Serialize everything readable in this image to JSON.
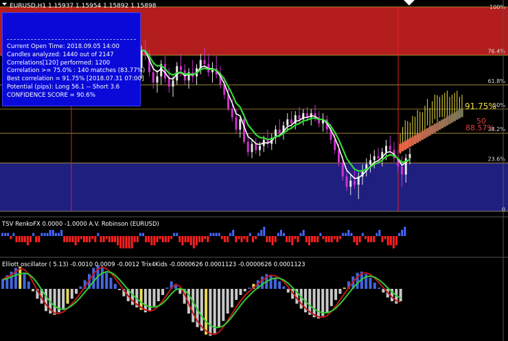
{
  "colors": {
    "background": "#000000",
    "bull_candle": "#e8e8e8",
    "bear_candle": "#cc33cc",
    "fast_ma": "#ffffff",
    "slow_ma": "#33dd33",
    "zone_top": "#b31d1d",
    "zone_bottom": "#1f1f80",
    "fib_line": "#e0c24a",
    "info_panel": "#0a0ad8",
    "histogram_up": "#4466ff",
    "histogram_down": "#ff2020",
    "elliott_up": "#4466dd",
    "elliott_down": "#c8c8c8",
    "elliott_highlight": "#e8d85a"
  },
  "chart_data": [
    {
      "type": "candlestick",
      "title": "EURUSD,H1  1.15937 1.15954 1.15892 1.15898",
      "symbol": "EURUSD",
      "timeframe": "H1",
      "ohlc": [
        1.15937,
        1.15954,
        1.15892,
        1.15898
      ],
      "fib_levels": [
        {
          "label": "100%",
          "pct": 100
        },
        {
          "label": "76.4%",
          "pct": 76.4
        },
        {
          "label": "61.8%",
          "pct": 61.8
        },
        {
          "label": "50%",
          "pct": 50
        },
        {
          "label": "38.2%",
          "pct": 38.2
        },
        {
          "label": "23.6%",
          "pct": 23.6
        },
        {
          "label": "0",
          "pct": 0
        }
      ],
      "zones": [
        {
          "name": "upper",
          "from_pct": 76.4,
          "to_pct": 100,
          "color": "#b31d1d"
        },
        {
          "name": "lower",
          "from_pct": 0,
          "to_pct": 23.6,
          "color": "#1f1f80"
        }
      ],
      "candles_pct": [
        [
          70,
          81,
          65,
          79
        ],
        [
          79,
          84,
          74,
          77
        ],
        [
          77,
          79,
          66,
          68
        ],
        [
          68,
          72,
          60,
          63
        ],
        [
          63,
          69,
          58,
          66
        ],
        [
          66,
          74,
          62,
          72
        ],
        [
          72,
          76,
          63,
          65
        ],
        [
          65,
          70,
          58,
          61
        ],
        [
          61,
          66,
          56,
          64
        ],
        [
          64,
          73,
          62,
          71
        ],
        [
          71,
          77,
          66,
          69
        ],
        [
          69,
          72,
          62,
          64
        ],
        [
          64,
          70,
          60,
          68
        ],
        [
          68,
          74,
          63,
          66
        ],
        [
          66,
          72,
          62,
          70
        ],
        [
          70,
          77,
          67,
          74
        ],
        [
          74,
          80,
          70,
          72
        ],
        [
          72,
          77,
          66,
          68
        ],
        [
          68,
          73,
          63,
          70
        ],
        [
          70,
          76,
          65,
          67
        ],
        [
          67,
          71,
          60,
          62
        ],
        [
          62,
          66,
          55,
          57
        ],
        [
          57,
          60,
          49,
          50
        ],
        [
          50,
          55,
          44,
          46
        ],
        [
          46,
          50,
          38,
          40
        ],
        [
          40,
          47,
          36,
          45
        ],
        [
          45,
          48,
          33,
          34
        ],
        [
          34,
          38,
          27,
          29
        ],
        [
          29,
          35,
          26,
          33
        ],
        [
          33,
          36,
          28,
          30
        ],
        [
          30,
          34,
          27,
          32
        ],
        [
          32,
          37,
          29,
          35
        ],
        [
          35,
          40,
          31,
          33
        ],
        [
          33,
          38,
          30,
          36
        ],
        [
          36,
          42,
          33,
          40
        ],
        [
          40,
          45,
          36,
          38
        ],
        [
          38,
          44,
          35,
          42
        ],
        [
          42,
          48,
          39,
          45
        ],
        [
          45,
          49,
          41,
          43
        ],
        [
          43,
          49,
          40,
          47
        ],
        [
          47,
          51,
          43,
          45
        ],
        [
          45,
          50,
          42,
          48
        ],
        [
          48,
          51,
          44,
          46
        ],
        [
          46,
          50,
          42,
          48
        ],
        [
          48,
          52,
          44,
          46
        ],
        [
          46,
          49,
          41,
          43
        ],
        [
          43,
          48,
          39,
          45
        ],
        [
          45,
          47,
          38,
          40
        ],
        [
          40,
          43,
          33,
          35
        ],
        [
          35,
          39,
          28,
          30
        ],
        [
          30,
          33,
          22,
          24
        ],
        [
          24,
          27,
          15,
          17
        ],
        [
          17,
          21,
          10,
          12
        ],
        [
          12,
          18,
          8,
          15
        ],
        [
          15,
          20,
          11,
          13
        ],
        [
          13,
          19,
          6,
          17
        ],
        [
          17,
          23,
          13,
          20
        ],
        [
          20,
          26,
          17,
          23
        ],
        [
          23,
          28,
          19,
          25
        ],
        [
          25,
          30,
          21,
          27
        ],
        [
          27,
          31,
          23,
          26
        ],
        [
          26,
          31,
          22,
          29
        ],
        [
          29,
          35,
          25,
          32
        ],
        [
          32,
          37,
          27,
          30
        ],
        [
          30,
          34,
          24,
          26
        ],
        [
          26,
          30,
          19,
          22
        ],
        [
          22,
          27,
          12,
          18
        ],
        [
          18,
          28,
          14,
          26
        ],
        [
          26,
          31,
          23,
          28
        ]
      ],
      "forecast": {
        "correlations": [
          {
            "label": "91.75%",
            "value": 91.75,
            "color": "#f0e040"
          },
          {
            "label": "88.57%",
            "value": 88.57,
            "color": "#e04040"
          }
        ],
        "mid_label": "50"
      }
    },
    {
      "type": "bar",
      "title": "TSV  RenkoFX 0.0000 -1.0000  A.V. Robinson (EURUSD)",
      "values": [
        1,
        1,
        1,
        -1,
        1,
        -2,
        -2,
        -2,
        -2,
        -3,
        -2,
        1,
        -2,
        -2,
        1,
        1,
        1,
        2,
        2,
        1,
        1,
        2,
        -2,
        -2,
        -2,
        -2,
        -3,
        -2,
        -1,
        -2,
        -2,
        -2,
        -1,
        -2,
        1,
        -2,
        -2,
        -1,
        -2,
        -2,
        -2,
        -3,
        -4,
        -4,
        -4,
        -4,
        -4,
        -2,
        -2,
        1,
        1,
        -2,
        -2,
        -3,
        -3,
        -2,
        -1,
        -2,
        -2,
        -2,
        -1,
        1,
        1,
        -2,
        -3,
        -2,
        -2,
        -3,
        -4,
        -3,
        -2,
        -2,
        -1,
        -2,
        1,
        1,
        1,
        1,
        -1,
        -2,
        -2,
        1,
        2,
        -2,
        -1,
        -2,
        -1,
        -2,
        1,
        -2,
        -1,
        1,
        2,
        3,
        -2,
        -2,
        -3,
        -2,
        1,
        2,
        1,
        -2,
        -2,
        -3,
        -1,
        -2,
        1,
        2,
        -2,
        -3,
        -2,
        -2,
        -2,
        1,
        -1,
        -2,
        -2,
        -2,
        -1,
        -2,
        -1,
        1,
        1,
        2,
        1,
        -2,
        -3,
        -2,
        1,
        -1,
        -2,
        -2,
        -2,
        1,
        2,
        -2,
        -1,
        -3,
        -3,
        -4,
        -3,
        1,
        2,
        3
      ],
      "ylim": [
        -4,
        3
      ]
    },
    {
      "type": "bar",
      "title": "Elliott oscillator ( 5.13) -0.0010 0.0009 -0.0012  Trix4Kids -0.0000626 0.0001123 -0.0000626 0.0001123",
      "values": [
        0.4,
        0.55,
        0.7,
        0.85,
        0.9,
        0.6,
        0.3,
        -0.1,
        -0.4,
        -0.6,
        -0.9,
        -1.0,
        -1.05,
        -0.95,
        -0.8,
        -0.6,
        -0.4,
        -0.2,
        0.1,
        0.35,
        0.6,
        0.85,
        0.95,
        0.85,
        0.65,
        0.45,
        0.2,
        -0.05,
        -0.3,
        -0.5,
        -0.65,
        -0.75,
        -0.85,
        -0.95,
        -0.9,
        -0.7,
        -0.5,
        -0.25,
        0.05,
        0.3,
        0.2,
        -0.2,
        -0.6,
        -1.0,
        -1.35,
        -1.55,
        -1.7,
        -1.85,
        -1.9,
        -1.8,
        -1.55,
        -1.3,
        -1.0,
        -0.75,
        -0.45,
        -0.25,
        -0.1,
        0.05,
        0.2,
        0.35,
        0.5,
        0.6,
        0.55,
        0.45,
        0.3,
        0.1,
        -0.15,
        -0.4,
        -0.6,
        -0.8,
        -0.95,
        -1.05,
        -1.15,
        -1.2,
        -1.1,
        -0.95,
        -0.7,
        -0.45,
        -0.2,
        0.05,
        0.3,
        0.5,
        0.65,
        0.7,
        0.6,
        0.45,
        0.25,
        0.05,
        -0.15,
        -0.35,
        -0.5,
        -0.6,
        -0.5
      ],
      "highlight_indices": [
        4,
        15,
        32,
        47,
        58,
        79
      ],
      "series": [
        {
          "name": "Elliott oscillator",
          "lineColor": "#c01818"
        },
        {
          "name": "Trix4Kids",
          "lineColor": "#33cc33"
        }
      ],
      "ylim": [
        -2,
        1.2
      ]
    }
  ],
  "info_panel": {
    "lines": [
      "Current Open Time: 2018.09.05 14:00",
      "Candles analyzed: 1440 out of 2147",
      "Correlations[120] performed: 1200",
      "Correlation >= 75.0% : 140 matches (83.77%)",
      "Best correlation = 91.75% [2018.07.31 07:00]",
      "Potential (pips): Long 56.1 -- Short 3.6",
      "CONFIDENCE SCORE = 90.6%"
    ]
  }
}
